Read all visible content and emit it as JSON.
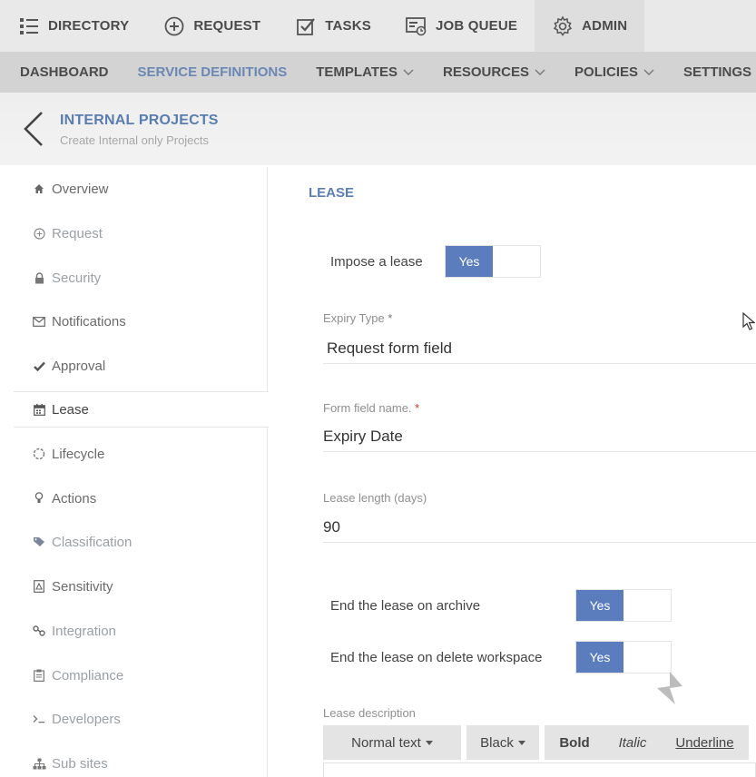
{
  "topnav": {
    "items": [
      {
        "label": "DIRECTORY",
        "icon": "directory-list-icon"
      },
      {
        "label": "REQUEST",
        "icon": "plus-circle-icon"
      },
      {
        "label": "TASKS",
        "icon": "checkbox-icon"
      },
      {
        "label": "JOB QUEUE",
        "icon": "job-queue-icon"
      },
      {
        "label": "ADMIN",
        "icon": "gear-icon"
      }
    ]
  },
  "subnav": {
    "items": [
      {
        "label": "DASHBOARD"
      },
      {
        "label": "SERVICE DEFINITIONS"
      },
      {
        "label": "TEMPLATES"
      },
      {
        "label": "RESOURCES"
      },
      {
        "label": "POLICIES"
      },
      {
        "label": "SETTINGS"
      }
    ]
  },
  "page": {
    "title": "INTERNAL PROJECTS",
    "subtitle": "Create Internal only Projects"
  },
  "sidebar": {
    "items": [
      {
        "label": "Overview",
        "icon": "home-icon"
      },
      {
        "label": "Request",
        "icon": "plus-circle-icon"
      },
      {
        "label": "Security",
        "icon": "lock-icon"
      },
      {
        "label": "Notifications",
        "icon": "envelope-icon"
      },
      {
        "label": "Approval",
        "icon": "check-icon"
      },
      {
        "label": "Lease",
        "icon": "calendar-icon"
      },
      {
        "label": "Lifecycle",
        "icon": "lifecycle-icon"
      },
      {
        "label": "Actions",
        "icon": "lightbulb-icon"
      },
      {
        "label": "Classification",
        "icon": "tag-icon"
      },
      {
        "label": "Sensitivity",
        "icon": "sensitivity-icon"
      },
      {
        "label": "Integration",
        "icon": "integration-icon"
      },
      {
        "label": "Compliance",
        "icon": "clipboard-icon"
      },
      {
        "label": "Developers",
        "icon": "terminal-icon"
      },
      {
        "label": "Sub sites",
        "icon": "sitemap-icon"
      }
    ]
  },
  "lease": {
    "section_title": "LEASE",
    "impose_label": "Impose a lease",
    "impose_value": "Yes",
    "expiry_type_label": "Expiry Type",
    "expiry_type_value": "Request form field",
    "form_field_label": "Form field name.",
    "form_field_value": "Expiry Date",
    "length_label": "Lease length (days)",
    "length_value": "90",
    "end_archive_label": "End the lease on archive",
    "end_archive_value": "Yes",
    "end_delete_label": "End the lease on delete workspace",
    "end_delete_value": "Yes",
    "description_label": "Lease description",
    "required_marker": "*"
  },
  "editor": {
    "style_label": "Normal text",
    "color_label": "Black",
    "bold_label": "Bold",
    "italic_label": "Italic",
    "underline_label": "Underline"
  },
  "colors": {
    "accent": "#5b7dbd",
    "title_blue": "#5a7db0",
    "topnav_bg": "#e9e9e9",
    "subnav_bg": "#d3d3d3"
  }
}
